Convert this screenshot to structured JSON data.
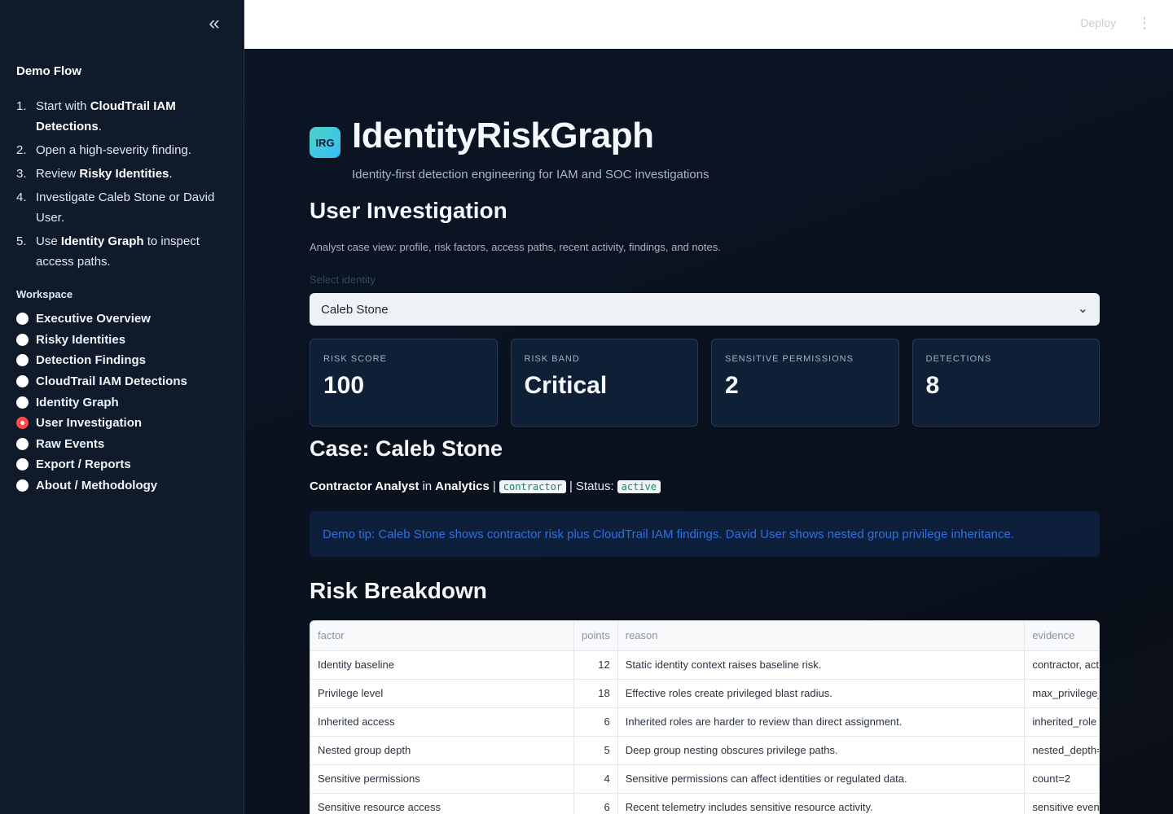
{
  "sidebar": {
    "collapse_icon": "«",
    "demo_flow_title": "Demo Flow",
    "steps": [
      {
        "num": "1.",
        "parts": [
          [
            "Start with ",
            false
          ],
          [
            "CloudTrail IAM Detections",
            true
          ],
          [
            ".",
            false
          ]
        ]
      },
      {
        "num": "2.",
        "parts": [
          [
            "Open a high-severity finding.",
            false
          ]
        ]
      },
      {
        "num": "3.",
        "parts": [
          [
            "Review ",
            false
          ],
          [
            "Risky Identities",
            true
          ],
          [
            ".",
            false
          ]
        ]
      },
      {
        "num": "4.",
        "parts": [
          [
            "Investigate Caleb Stone or David User.",
            false
          ]
        ]
      },
      {
        "num": "5.",
        "parts": [
          [
            "Use ",
            false
          ],
          [
            "Identity Graph",
            true
          ],
          [
            " to inspect access paths.",
            false
          ]
        ]
      }
    ],
    "workspace_title": "Workspace",
    "nav": [
      {
        "label": "Executive Overview",
        "active": false
      },
      {
        "label": "Risky Identities",
        "active": false
      },
      {
        "label": "Detection Findings",
        "active": false
      },
      {
        "label": "CloudTrail IAM Detections",
        "active": false
      },
      {
        "label": "Identity Graph",
        "active": false
      },
      {
        "label": "User Investigation",
        "active": true
      },
      {
        "label": "Raw Events",
        "active": false
      },
      {
        "label": "Export / Reports",
        "active": false
      },
      {
        "label": "About / Methodology",
        "active": false
      }
    ]
  },
  "header": {
    "deploy_label": "Deploy",
    "menu_icon": "⋮"
  },
  "app": {
    "logo_text": "IRG",
    "title": "IdentityRiskGraph",
    "subtitle": "Identity-first detection engineering for IAM and SOC investigations"
  },
  "page": {
    "title": "User Investigation",
    "description": "Analyst case view: profile, risk factors, access paths, recent activity, findings, and notes.",
    "select_label": "Select identity",
    "select_value": "Caleb Stone",
    "chevron_icon": "⌄"
  },
  "metrics": [
    {
      "label": "RISK SCORE",
      "value": "100"
    },
    {
      "label": "RISK BAND",
      "value": "Critical"
    },
    {
      "label": "SENSITIVE PERMISSIONS",
      "value": "2"
    },
    {
      "label": "DETECTIONS",
      "value": "8"
    }
  ],
  "case": {
    "title": "Case: Caleb Stone",
    "role": "Contractor Analyst",
    "in_text": "in",
    "department": "Analytics",
    "separator": "|",
    "type_tag": "contractor",
    "status_label": "Status:",
    "status_tag": "active"
  },
  "tip": "Demo tip: Caleb Stone shows contractor risk plus CloudTrail IAM findings. David User shows nested group privilege inheritance.",
  "risk": {
    "title": "Risk Breakdown",
    "columns": [
      "factor",
      "points",
      "reason",
      "evidence"
    ],
    "rows": [
      [
        "Identity baseline",
        "12",
        "Static identity context raises baseline risk.",
        "contractor, act"
      ],
      [
        "Privilege level",
        "18",
        "Effective roles create privileged blast radius.",
        "max_privilege_"
      ],
      [
        "Inherited access",
        "6",
        "Inherited roles are harder to review than direct assignment.",
        "inherited_role"
      ],
      [
        "Nested group depth",
        "5",
        "Deep group nesting obscures privilege paths.",
        "nested_depth="
      ],
      [
        "Sensitive permissions",
        "4",
        "Sensitive permissions can affect identities or regulated data.",
        "count=2"
      ],
      [
        "Sensitive resource access",
        "6",
        "Recent telemetry includes sensitive resource activity.",
        "sensitive even"
      ]
    ]
  }
}
